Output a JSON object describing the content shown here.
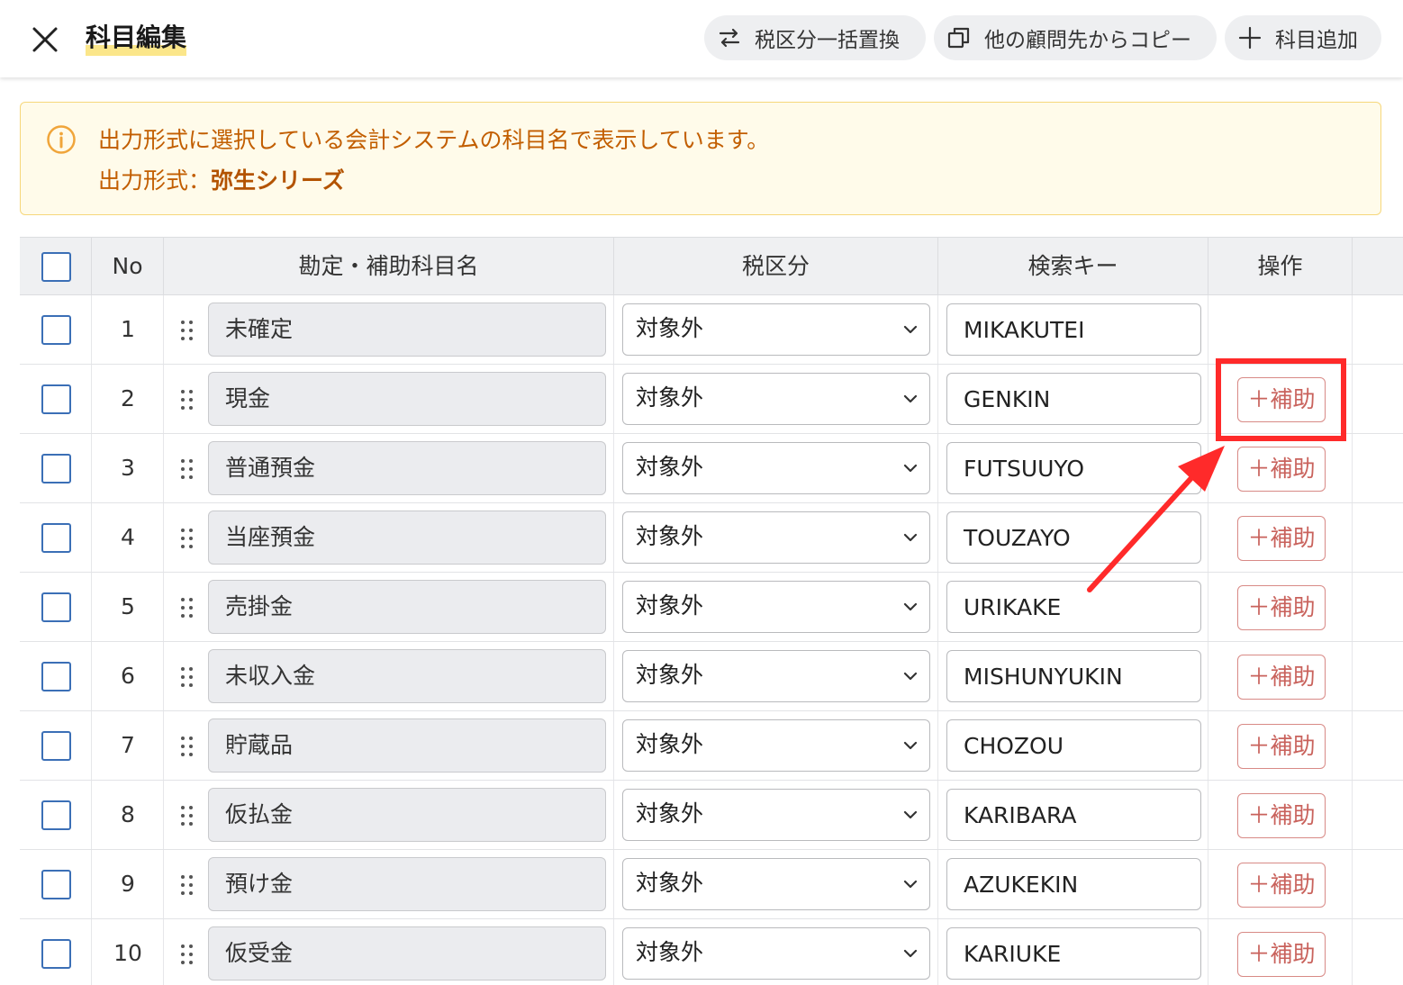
{
  "header": {
    "title": "科目編集",
    "buttons": {
      "tax_replace": "税区分一括置換",
      "copy_from_client": "他の顧問先からコピー",
      "add_account": "科目追加"
    }
  },
  "notice": {
    "line1": "出力形式に選択している会計システムの科目名で表示しています。",
    "line2_label": "出力形式：",
    "line2_value": "弥生シリーズ",
    "icon": "info-icon"
  },
  "table": {
    "headers": {
      "no": "No",
      "name": "勘定・補助科目名",
      "tax": "税区分",
      "key": "検索キー",
      "op": "操作"
    },
    "sub_label": "＋補助",
    "rows": [
      {
        "no": "1",
        "name": "未確定",
        "tax": "対象外",
        "key": "MIKAKUTEI"
      },
      {
        "no": "2",
        "name": "現金",
        "tax": "対象外",
        "key": "GENKIN"
      },
      {
        "no": "3",
        "name": "普通預金",
        "tax": "対象外",
        "key": "FUTSUUYO"
      },
      {
        "no": "4",
        "name": "当座預金",
        "tax": "対象外",
        "key": "TOUZAYO"
      },
      {
        "no": "5",
        "name": "売掛金",
        "tax": "対象外",
        "key": "URIKAKE"
      },
      {
        "no": "6",
        "name": "未収入金",
        "tax": "対象外",
        "key": "MISHUNYUKIN"
      },
      {
        "no": "7",
        "name": "貯蔵品",
        "tax": "対象外",
        "key": "CHOZOU"
      },
      {
        "no": "8",
        "name": "仮払金",
        "tax": "対象外",
        "key": "KARIBARA"
      },
      {
        "no": "9",
        "name": "預け金",
        "tax": "対象外",
        "key": "AZUKEKIN"
      },
      {
        "no": "10",
        "name": "仮受金",
        "tax": "対象外",
        "key": "KARIUKE"
      }
    ]
  },
  "colors": {
    "accent_border": "#3b6fb6",
    "notice_text": "#c25e00",
    "sub_button": "#c9625c",
    "annotation_red": "#ff2a2a"
  }
}
